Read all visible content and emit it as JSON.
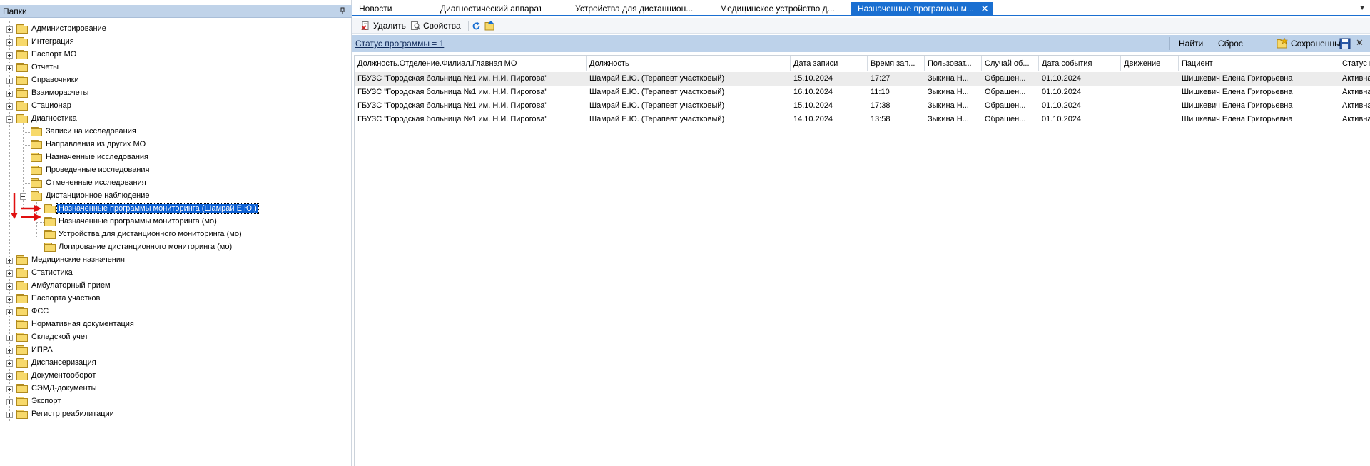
{
  "left_panel": {
    "title": "Папки",
    "tree": [
      {
        "label": "Администрирование"
      },
      {
        "label": "Интеграция"
      },
      {
        "label": "Паспорт МО"
      },
      {
        "label": "Отчеты"
      },
      {
        "label": "Справочники"
      },
      {
        "label": "Взаиморасчеты"
      },
      {
        "label": "Стационар"
      },
      {
        "label": "Диагностика"
      },
      {
        "label": "Записи на исследования"
      },
      {
        "label": "Направления из других МО"
      },
      {
        "label": "Назначенные исследования"
      },
      {
        "label": "Проведенные исследования"
      },
      {
        "label": "Отмененные исследования"
      },
      {
        "label": "Дистанционное наблюдение"
      },
      {
        "label": "Назначенные программы мониторинга (Шамрай Е.Ю.)"
      },
      {
        "label": "Назначенные программы мониторинга (мо)"
      },
      {
        "label": "Устройства для дистанционного мониторинга (мо)"
      },
      {
        "label": "Логирование дистанционного мониторинга (мо)"
      },
      {
        "label": "Медицинские назначения"
      },
      {
        "label": "Статистика"
      },
      {
        "label": "Амбулаторный прием"
      },
      {
        "label": "Паспорта участков"
      },
      {
        "label": "ФСС"
      },
      {
        "label": "Нормативная документация"
      },
      {
        "label": "Складской учет"
      },
      {
        "label": "ИПРА"
      },
      {
        "label": "Диспансеризация"
      },
      {
        "label": "Документооборот"
      },
      {
        "label": "СЭМД-документы"
      },
      {
        "label": "Экспорт"
      },
      {
        "label": "Регистр реабилитации"
      }
    ]
  },
  "tabs": [
    {
      "label": "Новости"
    },
    {
      "label": "Диагностический аппарат"
    },
    {
      "label": "Устройства для дистанцион..."
    },
    {
      "label": "Медицинское устройство д..."
    },
    {
      "label": "Назначенные программы м..."
    }
  ],
  "toolbar": {
    "delete_label": "Удалить",
    "properties_label": "Свойства"
  },
  "filter": {
    "status_text": "Статус программы = 1",
    "find_label": "Найти",
    "reset_label": "Сброс",
    "saved_label": "Сохраненные"
  },
  "grid": {
    "columns": [
      "Должность.Отделение.Филиал.Главная МО",
      "Должность",
      "Дата записи",
      "Время зап...",
      "Пользоват...",
      "Случай об...",
      "Дата события",
      "Движение",
      "Пациент",
      "Статус п"
    ],
    "rows": [
      [
        "ГБУЗС \"Городская больница №1 им. Н.И. Пирогова\"",
        "Шамрай Е.Ю. (Терапевт участковый)",
        "15.10.2024",
        "17:27",
        "Зыкина Н...",
        "Обращен...",
        "01.10.2024",
        "",
        "Шишкевич Елена Григорьевна",
        "Активна"
      ],
      [
        "ГБУЗС \"Городская больница №1 им. Н.И. Пирогова\"",
        "Шамрай Е.Ю. (Терапевт участковый)",
        "16.10.2024",
        "11:10",
        "Зыкина Н...",
        "Обращен...",
        "01.10.2024",
        "",
        "Шишкевич Елена Григорьевна",
        "Активна"
      ],
      [
        "ГБУЗС \"Городская больница №1 им. Н.И. Пирогова\"",
        "Шамрай Е.Ю. (Терапевт участковый)",
        "15.10.2024",
        "17:38",
        "Зыкина Н...",
        "Обращен...",
        "01.10.2024",
        "",
        "Шишкевич Елена Григорьевна",
        "Активна"
      ],
      [
        "ГБУЗС \"Городская больница №1 им. Н.И. Пирогова\"",
        "Шамрай Е.Ю. (Терапевт участковый)",
        "14.10.2024",
        "13:58",
        "Зыкина Н...",
        "Обращен...",
        "01.10.2024",
        "",
        "Шишкевич Елена Григорьевна",
        "Активна"
      ]
    ]
  },
  "colors": {
    "accent": "#1a6fd1",
    "selection": "#0a5fd4",
    "panel_header": "#c0d3e9",
    "annotation_arrow": "#e01010"
  }
}
